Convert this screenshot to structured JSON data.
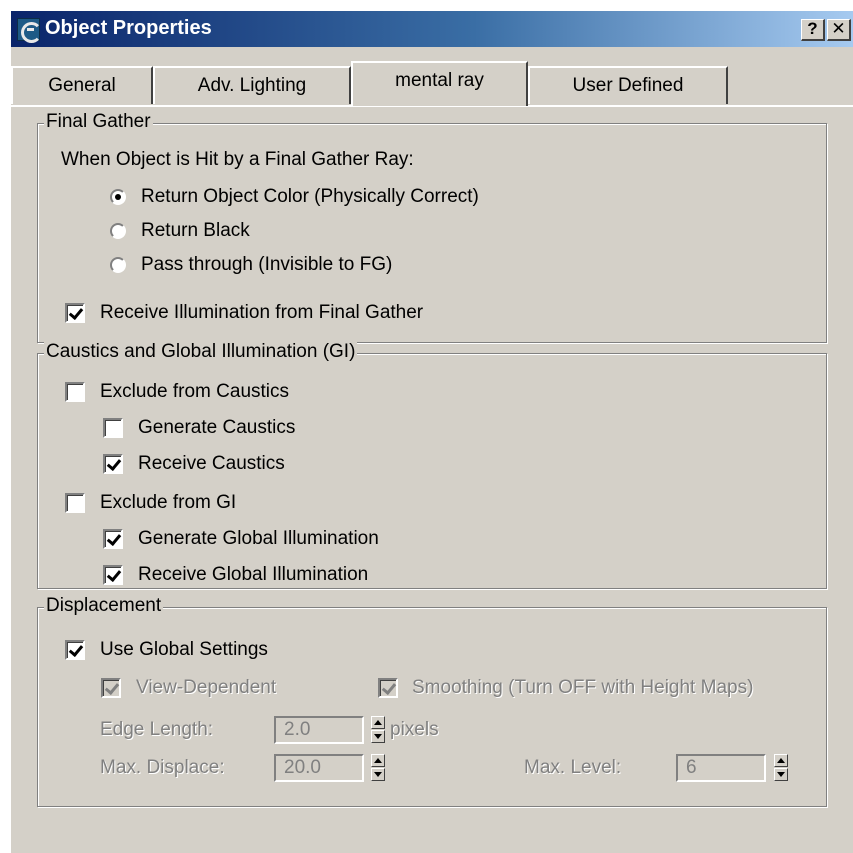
{
  "window": {
    "title": "Object Properties",
    "help_label": "?",
    "close_label": "✕"
  },
  "tabs": [
    {
      "label": "General"
    },
    {
      "label": "Adv. Lighting"
    },
    {
      "label": "mental ray"
    },
    {
      "label": "User Defined"
    }
  ],
  "final_gather": {
    "legend": "Final Gather",
    "prompt": "When Object is Hit by a Final Gather Ray:",
    "options": [
      {
        "label": "Return Object Color (Physically Correct)",
        "selected": true
      },
      {
        "label": "Return Black",
        "selected": false
      },
      {
        "label": "Pass through (Invisible to FG)",
        "selected": false
      }
    ],
    "receive_label": "Receive Illumination from Final Gather",
    "receive_checked": true
  },
  "caustics_gi": {
    "legend": "Caustics and Global Illumination (GI)",
    "exclude_caustics": "Exclude from Caustics",
    "generate_caustics": "Generate Caustics",
    "receive_caustics": "Receive Caustics",
    "exclude_gi": "Exclude from GI",
    "generate_gi": "Generate Global Illumination",
    "receive_gi": "Receive Global Illumination"
  },
  "displacement": {
    "legend": "Displacement",
    "use_global": "Use Global Settings",
    "view_dependent": "View-Dependent",
    "smoothing": "Smoothing (Turn OFF with Height Maps)",
    "edge_length_label": "Edge Length:",
    "edge_length_value": "2.0",
    "edge_length_unit": "pixels",
    "max_displace_label": "Max. Displace:",
    "max_displace_value": "20.0",
    "max_level_label": "Max. Level:",
    "max_level_value": "6"
  }
}
